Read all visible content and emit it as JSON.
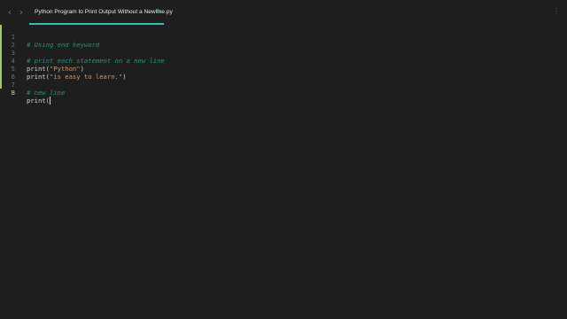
{
  "tab": {
    "title": "Python Program to Print Output Without a Newline.py"
  },
  "navigation": {
    "back_icon": "chevron-left-icon",
    "forward_icon": "chevron-right-icon"
  },
  "editor": {
    "current_line": 8,
    "lines": [
      {
        "number": "1",
        "text": "# Using end keyword"
      },
      {
        "number": "2",
        "text": ""
      },
      {
        "number": "3",
        "text": "# print each statement on a new line"
      },
      {
        "number": "4",
        "text_prefix": "print(",
        "text_string": "\"Python\"",
        "text_suffix": ")"
      },
      {
        "number": "5",
        "text_prefix": "print(",
        "text_string": "\"is easy to learn.\"",
        "text_suffix": ")"
      },
      {
        "number": "6",
        "text": ""
      },
      {
        "number": "7",
        "text": "# new line"
      },
      {
        "number": "8",
        "text_prefix": "print",
        "text_paren": "("
      }
    ]
  },
  "colors": {
    "background": "#1e1e1e",
    "tab_accent": "#3fb6b0",
    "comment": "#2f8f73",
    "string": "#ce9a6f",
    "change_bar": "#9cc96b"
  }
}
